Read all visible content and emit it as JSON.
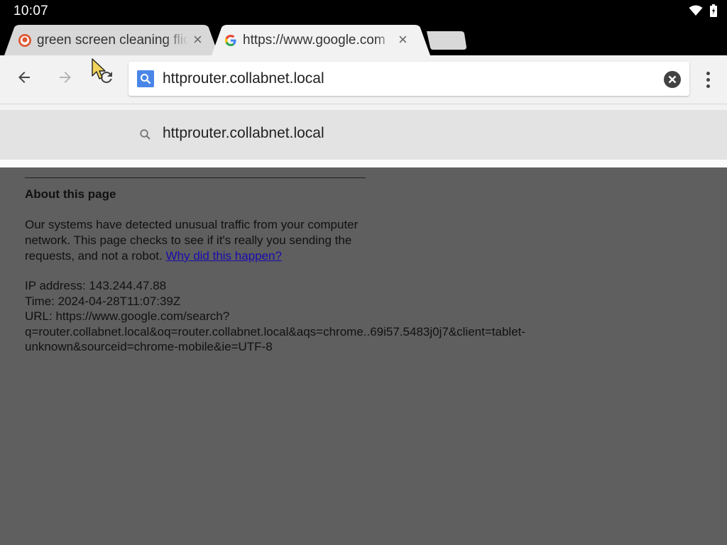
{
  "status_bar": {
    "time": "10:07",
    "icons": [
      "wifi-icon",
      "battery-icon"
    ]
  },
  "tabs": [
    {
      "title": "green screen cleaning flic",
      "favicon": "duckduckgo-icon",
      "active": false
    },
    {
      "title": "https://www.google.com",
      "favicon": "google-icon",
      "active": true
    }
  ],
  "toolbar": {
    "back_icon": "arrow-left-icon",
    "forward_icon": "arrow-right-icon",
    "reload_icon": "reload-icon",
    "omnibox_value": "httprouter.collabnet.local",
    "menu_icon": "more-vert-icon"
  },
  "suggestions": [
    {
      "icon": "search-icon",
      "text": "httprouter.collabnet.local"
    }
  ],
  "page": {
    "heading": "About this page",
    "body_text": "Our systems have detected unusual traffic from your computer network. This page checks to see if it's really you sending the requests, and not a robot. ",
    "link_text": "Why did this happen?",
    "ip_line": "IP address: 143.244.47.88",
    "time_line": "Time: 2024-04-28T11:07:39Z",
    "url_line_1": "URL: https://www.google.com/search?",
    "url_line_2": "q=router.collabnet.local&oq=router.collabnet.local&aqs=chrome..69i57.5483j0j7&client=tablet-",
    "url_line_3": "unknown&sourceid=chrome-mobile&ie=UTF-8"
  },
  "colors": {
    "status_bar": "#000000",
    "toolbar": "#f2f2f2",
    "page_overlay": "#5f5f5f",
    "link": "#1a0dab",
    "accent_blue": "#4a86e8"
  }
}
